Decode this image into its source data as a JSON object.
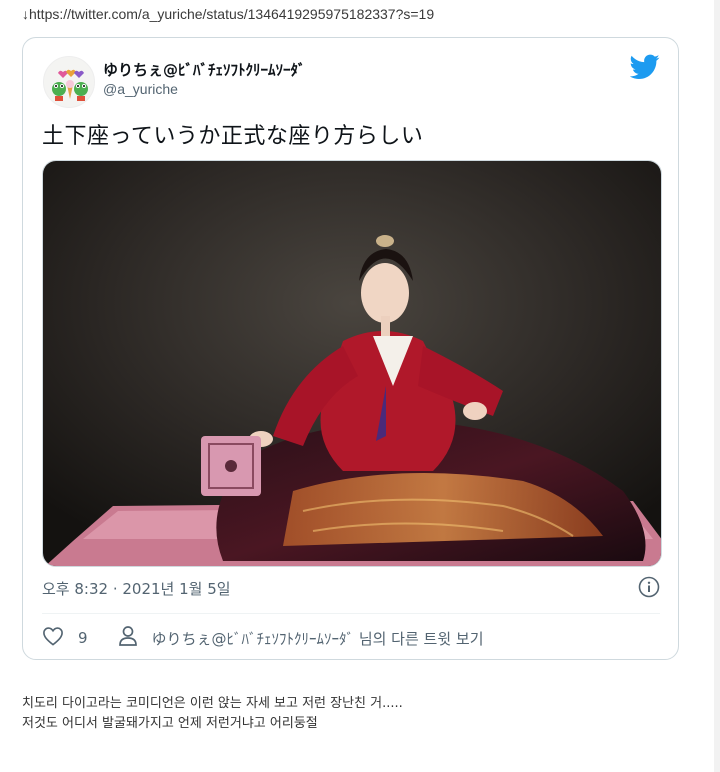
{
  "source_link": "↓https://twitter.com/a_yuriche/status/1346419295975182337?s=19",
  "tweet": {
    "display_name": "ゆりちぇ@ﾋﾞﾊﾞﾁｪｿﾌﾄｸﾘｰﾑｿｰﾀﾞ",
    "handle": "@a_yuriche",
    "text": "土下座っていうか正式な座り方らしい",
    "timestamp": "오후 8:32 · 2021년 1월 5일",
    "like_count": "9",
    "profile_link": "ゆりちぇ@ﾋﾞﾊﾞﾁｪｿﾌﾄｸﾘｰﾑｿｰﾀﾞ 님의 다른 트윗 보기"
  },
  "icons": {
    "twitter_logo": "twitter-bird-icon",
    "info": "info-icon",
    "like": "heart-icon",
    "profile": "person-icon"
  },
  "colors": {
    "twitter_blue": "#1d9bf0",
    "text_secondary": "#536471",
    "border": "#cfd9de"
  },
  "comment": {
    "line1": "치도리 다이고라는 코미디언은 이런 앉는 자세 보고 저런 장난친 거.....",
    "line2": "저것도 어디서 발굴돼가지고 언제 저런거냐고 어리둥절"
  }
}
